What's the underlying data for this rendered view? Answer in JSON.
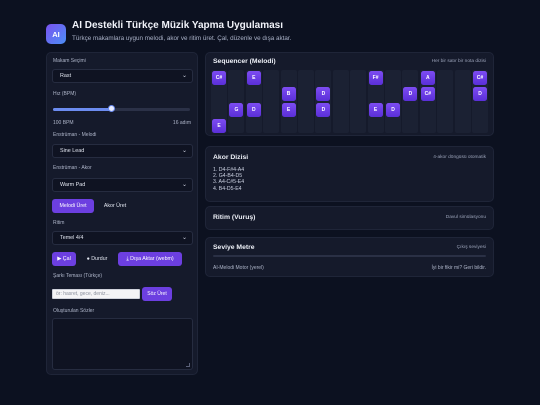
{
  "app": {
    "logo": "AI",
    "title": "AI Destekli Türkçe Müzik Yapma Uygulaması",
    "subtitle": "Türkçe makamlara uygun melodi, akor ve ritim üret. Çal, düzenle ve dışa aktar."
  },
  "controls": {
    "makam_label": "Makam Seçimi",
    "makam_value": "Rast",
    "tempo_label": "Hız (BPM)",
    "tempo_value_text": "100 BPM",
    "tempo_step_text": "16 adım",
    "tempo_fraction": 0.43,
    "melody_instrument_label": "Enstrüman - Melodi",
    "melody_instrument_value": "Sine Lead",
    "chord_instrument_label": "Enstrüman - Akor",
    "chord_instrument_value": "Warm Pad",
    "generate_melody_label": "Melodi Üret",
    "generate_chords_label": "Akor Üret",
    "rhythm_label": "Ritim",
    "rhythm_value": "Temel 4/4",
    "play_label": "▶ Çal",
    "stop_label": "● Durdur",
    "export_label": "⤓ Dışa Aktar (webm)",
    "lyrics_theme_label": "Şarkı Teması (Türkçe)",
    "lyrics_placeholder": "ör: hasret, gece, deniz...",
    "lyrics_button_label": "Söz Üret",
    "generated_lyrics_label": "Oluşturulan Sözler"
  },
  "sequencer": {
    "title": "Sequencer (Melodi)",
    "hint": "Her bir satır bir nota dizisi",
    "columns": 16,
    "notes": [
      {
        "col": 0,
        "row": 0,
        "label": "C#"
      },
      {
        "col": 2,
        "row": 0,
        "label": "E"
      },
      {
        "col": 9,
        "row": 0,
        "label": "F#"
      },
      {
        "col": 12,
        "row": 0,
        "label": "A"
      },
      {
        "col": 15,
        "row": 0,
        "label": "C#"
      },
      {
        "col": 4,
        "row": 1,
        "label": "B"
      },
      {
        "col": 6,
        "row": 1,
        "label": "D"
      },
      {
        "col": 11,
        "row": 1,
        "label": "D"
      },
      {
        "col": 12,
        "row": 1,
        "label": "C#"
      },
      {
        "col": 15,
        "row": 1,
        "label": "D"
      },
      {
        "col": 1,
        "row": 2,
        "label": "G"
      },
      {
        "col": 2,
        "row": 2,
        "label": "D"
      },
      {
        "col": 4,
        "row": 2,
        "label": "E"
      },
      {
        "col": 6,
        "row": 2,
        "label": "D"
      },
      {
        "col": 9,
        "row": 2,
        "label": "E"
      },
      {
        "col": 10,
        "row": 2,
        "label": "D"
      },
      {
        "col": 0,
        "row": 3,
        "label": "E"
      }
    ]
  },
  "chords": {
    "title": "Akor Dizisi",
    "hint": "4-akor döngüsü otomatik",
    "items": [
      "1. D4-F#4-A4",
      "2. G4-B4-D5",
      "3. A4-C#5-E4",
      "4. B4-D5-E4"
    ]
  },
  "rhythm": {
    "title": "Ritim (Vuruş)",
    "hint": "Davul simülasyonu"
  },
  "meter": {
    "title": "Seviye Metre",
    "hint": "Çıkış seviyesi",
    "footer_left": "AI-Melodi Motor (yerel)",
    "footer_right": "İyi bir fikir mi? Geri bildir."
  }
}
